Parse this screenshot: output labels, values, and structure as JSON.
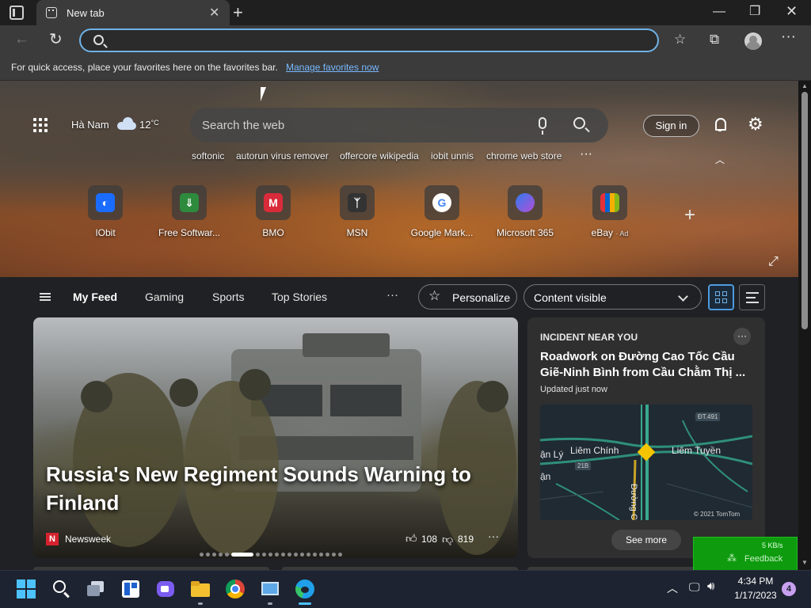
{
  "browser": {
    "tab_title": "New tab",
    "favorites_prompt": "For quick access, place your favorites here on the favorites bar.",
    "manage_favorites": "Manage favorites now",
    "address_value": ""
  },
  "header": {
    "location": "Hà Nam",
    "temperature": "12",
    "temperature_unit": "°C",
    "search_placeholder": "Search the web",
    "sign_in": "Sign in"
  },
  "trending": [
    "softonic",
    "autorun virus remover",
    "offercore wikipedia",
    "iobit unnis",
    "chrome web store"
  ],
  "quick_links": [
    {
      "label": "IObit",
      "color": "#1a6cff"
    },
    {
      "label": "Free Softwar...",
      "color": "#2e8b3d"
    },
    {
      "label": "BMO",
      "color": "#d92b3a"
    },
    {
      "label": "MSN",
      "color": "#333333"
    },
    {
      "label": "Google Mark...",
      "color": "#ffffff"
    },
    {
      "label": "Microsoft 365",
      "color": "#7b5cf0"
    },
    {
      "label": "eBay",
      "badge": "· Ad",
      "color": "#f5c400"
    }
  ],
  "feed_tabs": [
    "My Feed",
    "Gaming",
    "Sports",
    "Top Stories"
  ],
  "personalize_label": "Personalize",
  "content_visibility": "Content visible",
  "story": {
    "headline": "Russia's New Regiment Sounds Warning to Finland",
    "publisher": "Newsweek",
    "publisher_initial": "N",
    "likes": "108",
    "dislikes": "819"
  },
  "incident": {
    "kicker": "INCIDENT NEAR YOU",
    "title": "Roadwork on Đường Cao Tốc Cầu Giẽ-Ninh Bình from Cầu Chằm Thị ...",
    "updated": "Updated just now",
    "map_labels": {
      "place1": "Liêm Chính",
      "place2": "Liêm Tuyền",
      "place3": "ận Lý",
      "road_primary": "Đường C",
      "road_small": "ĐT.491",
      "route_badge": "21B",
      "edge_fragment": "ận",
      "attribution": "© 2021 TomTom"
    },
    "see_more": "See more"
  },
  "network_widget": {
    "speed": "5 KB/s",
    "feedback": "Feedback"
  },
  "taskbar": {
    "time": "4:34 PM",
    "date": "1/17/2023",
    "notifications": "4"
  }
}
